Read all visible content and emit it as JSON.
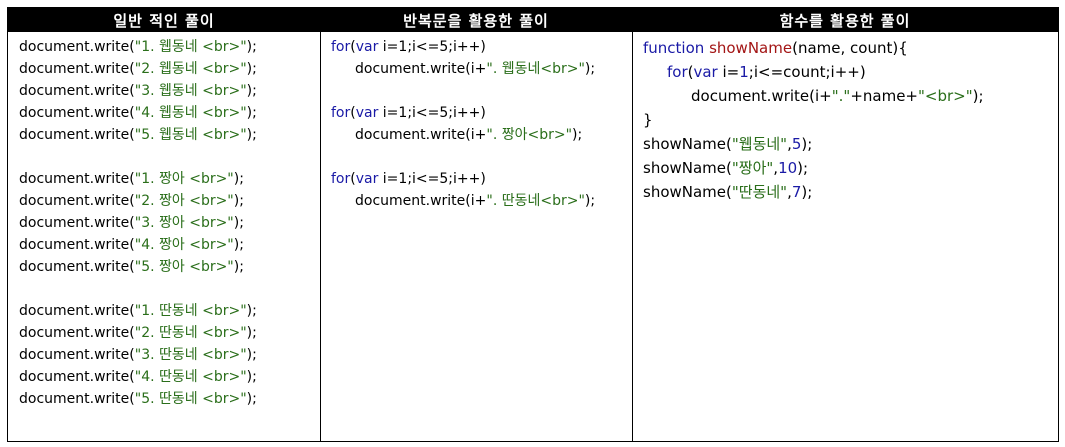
{
  "headers": {
    "col1": "일반 적인 풀이",
    "col2": "반복문을 활용한 풀이",
    "col3": "함수를 활용한 풀이"
  },
  "col1": {
    "prefix": "document.write(",
    "suffix": ");",
    "groups": [
      [
        "\"1. 웹동네 <br>\"",
        "\"2. 웹동네 <br>\"",
        "\"3. 웹동네 <br>\"",
        "\"4. 웹동네 <br>\"",
        "\"5. 웹동네 <br>\""
      ],
      [
        "\"1. 짱아 <br>\"",
        "\"2. 짱아 <br>\"",
        "\"3. 짱아 <br>\"",
        "\"4. 짱아 <br>\"",
        "\"5. 짱아 <br>\""
      ],
      [
        "\"1. 딴동네 <br>\"",
        "\"2. 딴동네 <br>\"",
        "\"3. 딴동네 <br>\"",
        "\"4. 딴동네 <br>\"",
        "\"5. 딴동네 <br>\""
      ]
    ]
  },
  "col2": {
    "loops": [
      {
        "for_kw": "for",
        "open": "(",
        "var_kw": "var",
        "cond": " i=1;i<=5;i++)",
        "body_prefix": "document.write(i+",
        "body_str": "\". 웹동네<br>\"",
        "body_suffix": ");"
      },
      {
        "for_kw": "for",
        "open": "(",
        "var_kw": "var",
        "cond": " i=1;i<=5;i++)",
        "body_prefix": "document.write(i+",
        "body_str": "\". 짱아<br>\"",
        "body_suffix": ");"
      },
      {
        "for_kw": "for",
        "open": "(",
        "var_kw": "var",
        "cond": " i=1;i<=5;i++)",
        "body_prefix": "document.write(i+",
        "body_str": "\". 딴동네<br>\"",
        "body_suffix": ");"
      }
    ]
  },
  "col3": {
    "func_kw": "function",
    "func_name": "showName",
    "params": "(name, count){",
    "for_kw": "for",
    "open": "(",
    "var_kw": "var",
    "loop_a": " i=",
    "loop_one": "1",
    "loop_b": ";i<=count;i++)",
    "body_a": "document.write(i+",
    "body_s1": "\".\"",
    "body_b": "+name+",
    "body_s2": "\"<br>\"",
    "body_c": ");",
    "close": "}",
    "calls": [
      {
        "name": "showName(",
        "arg": "\"웹동네\"",
        "sep": ",",
        "num": "5",
        "end": ");"
      },
      {
        "name": "showName(",
        "arg": "\"짱아\"",
        "sep": ",",
        "num": "10",
        "end": ");"
      },
      {
        "name": "showName(",
        "arg": "\"딴동네\"",
        "sep": ",",
        "num": "7",
        "end": ");"
      }
    ]
  }
}
